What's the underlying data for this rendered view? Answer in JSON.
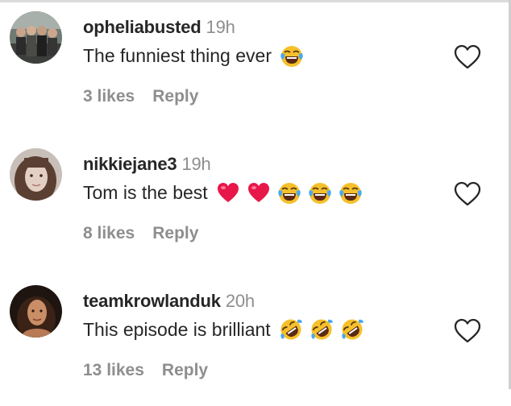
{
  "comments": [
    {
      "username": "opheliabusted",
      "time": "19h",
      "text": "The funniest thing ever",
      "emojis": [
        "face-with-tears-of-joy-icon"
      ],
      "likes": "3 likes",
      "reply": "Reply"
    },
    {
      "username": "nikkiejane3",
      "time": "19h",
      "text": "Tom is the best",
      "emojis": [
        "red-heart-icon",
        "red-heart-icon",
        "face-with-tears-of-joy-icon",
        "face-with-tears-of-joy-icon",
        "face-with-tears-of-joy-icon"
      ],
      "likes": "8 likes",
      "reply": "Reply"
    },
    {
      "username": "teamkrowlanduk",
      "time": "20h",
      "text": "This episode is brilliant",
      "emojis": [
        "rolling-on-the-floor-laughing-icon",
        "rolling-on-the-floor-laughing-icon",
        "rolling-on-the-floor-laughing-icon"
      ],
      "likes": "13 likes",
      "reply": "Reply"
    }
  ],
  "colors": {
    "text": "#262626",
    "secondary": "#8e8e8e",
    "heart_emoji": "#e8174a",
    "emoji_face": "#f5c02c"
  },
  "icons": {
    "like_button": "heart-outline-icon"
  }
}
